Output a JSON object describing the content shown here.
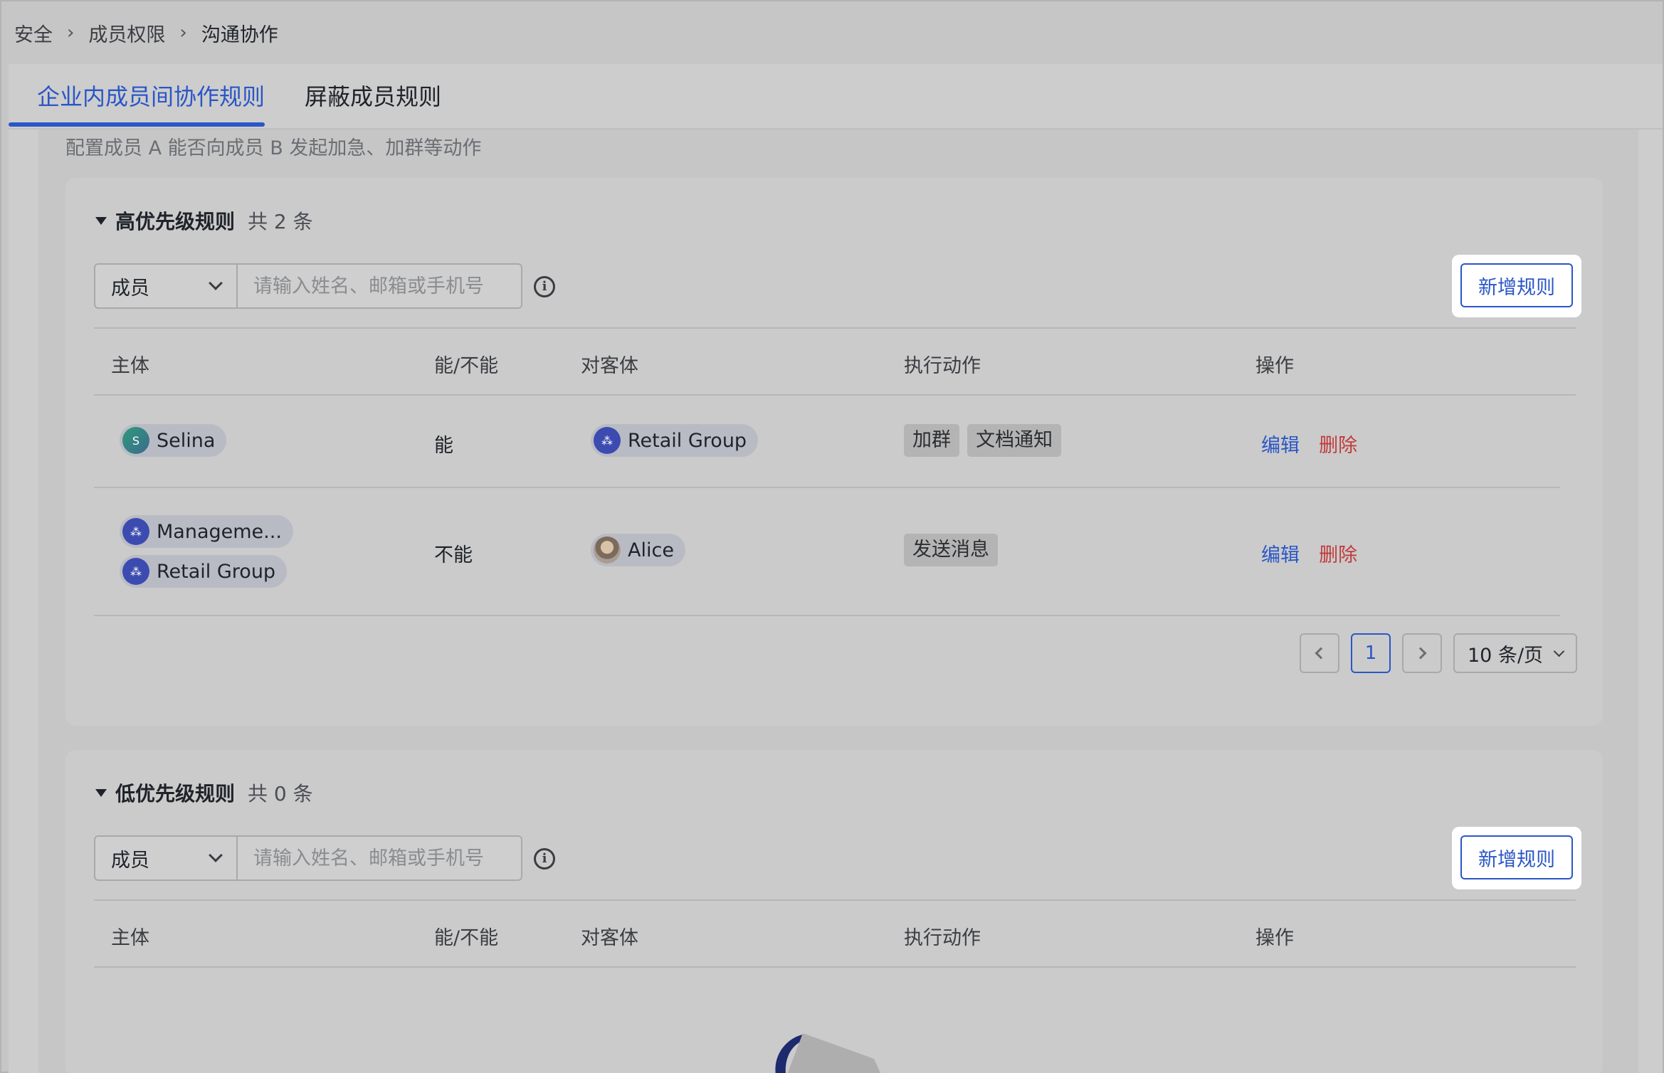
{
  "breadcrumb": {
    "items": [
      "安全",
      "成员权限",
      "沟通协作"
    ],
    "separator": ">"
  },
  "tabs": [
    {
      "label": "企业内成员间协作规则",
      "active": true
    },
    {
      "label": "屏蔽成员规则",
      "active": false
    }
  ],
  "description": "配置成员 A 能否向成员 B 发起加急、加群等动作",
  "high": {
    "title": "高优先级规则",
    "count": "共 2 条",
    "filter_select": "成员",
    "search_placeholder": "请输入姓名、邮箱或手机号",
    "new_rule": "新增规则",
    "columns": [
      "主体",
      "能/不能",
      "对客体",
      "执行动作",
      "操作"
    ],
    "rows": [
      {
        "subjects": [
          {
            "name": "Selina",
            "avatar": "S"
          }
        ],
        "permission": "能",
        "objects": [
          {
            "name": "Retail Group"
          }
        ],
        "actions": [
          "加群",
          "文档通知"
        ],
        "edit": "编辑",
        "delete": "删除"
      },
      {
        "subjects": [
          {
            "name": "Manageme..."
          },
          {
            "name": "Retail Group"
          }
        ],
        "permission": "不能",
        "objects": [
          {
            "name": "Alice"
          }
        ],
        "actions": [
          "发送消息"
        ],
        "edit": "编辑",
        "delete": "删除"
      }
    ],
    "pagination": {
      "current_page": "1",
      "page_size": "10 条/页"
    }
  },
  "low": {
    "title": "低优先级规则",
    "count": "共 0 条",
    "filter_select": "成员",
    "search_placeholder": "请输入姓名、邮箱或手机号",
    "new_rule": "新增规则",
    "columns": [
      "主体",
      "能/不能",
      "对客体",
      "执行动作",
      "操作"
    ]
  },
  "colors": {
    "accent": "#2a56c6",
    "danger": "#c23a3a",
    "group_avatar": "#3c4bb0"
  }
}
